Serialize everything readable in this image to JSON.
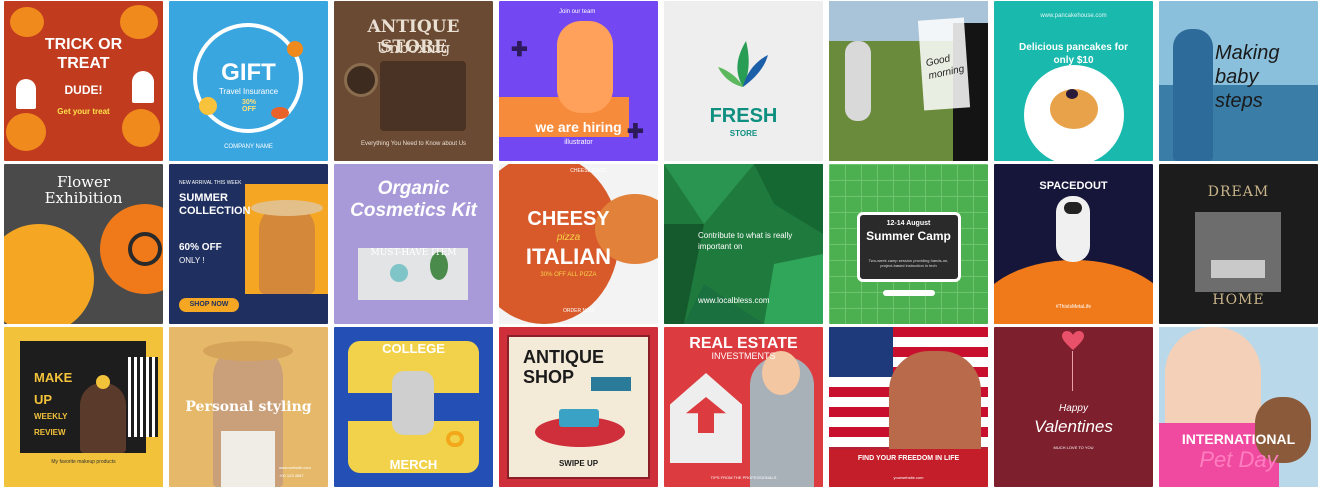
{
  "colors": {
    "halloween_bg": "#c13c1f",
    "gift_bg": "#3aa6e0",
    "antique_bg": "#6b4a33",
    "hiring_bg": "#7348f2",
    "fresh_green": "#0f8f80",
    "teal_bg": "#19b9ad",
    "flower_bg": "#555555",
    "summer_blue": "#1f2f60",
    "organic_bg": "#a89ad8",
    "polygon_green": "#1f7a3e",
    "camp_green": "#4caf50",
    "space_navy": "#15163a",
    "dark_bg": "#1c1c1c",
    "makeup_yellow": "#f2c23b",
    "styling_bg": "#e6b96a",
    "college_blue": "#2450b5",
    "antique_shop_red": "#cf2f3b",
    "realestate_red": "#dc3b3f",
    "valentine_maroon": "#7d1f2c",
    "pet_pink": "#f04aa0"
  },
  "tiles": {
    "t1": {
      "title": "TRICK OR TREAT",
      "sub": "DUDE!",
      "cta": "Get your treat"
    },
    "t2": {
      "title": "GIFT",
      "sub": "Travel Insurance",
      "disc": "30% OFF",
      "footer": "COMPANY NAME"
    },
    "t3": {
      "title": "ANTIQUE STORE",
      "sub": "Unboxing",
      "footer": "Everything You Need to Know about Us"
    },
    "t4": {
      "top": "Join our team",
      "title": "we are hiring",
      "sub": "illustrator"
    },
    "t5": {
      "title": "FRESH",
      "sub": "STORE"
    },
    "t6": {
      "title": "Good morning"
    },
    "t7": {
      "url": "www.pancakehouse.com",
      "title": "Delicious pancakes for only $10"
    },
    "t8": {
      "title": "Making baby steps"
    },
    "t9": {
      "title": "Flower Exhibition"
    },
    "t10": {
      "top": "NEW ARRIVAL THIS WEEK",
      "title": "SUMMER COLLECTION",
      "disc": "60% OFF",
      "sub": "ONLY !",
      "cta": "SHOP NOW"
    },
    "t11": {
      "title": "Organic Cosmetics Kit",
      "sub": "MUST-HAVE ITEM"
    },
    "t12": {
      "top": "CHEESE FOOD",
      "title": "CHEESY",
      "mid": "pizza",
      "title2": "ITALIAN",
      "disc": "30% OFF ALL PIZZA",
      "cta": "ORDER NOW"
    },
    "t13": {
      "title": "Contribute to what is really important on",
      "url": "www.localbless.com"
    },
    "t14": {
      "date": "12-14 August",
      "title": "Summer Camp",
      "sub": "Two-week camp session providing hands-on, project-based instruction in tech"
    },
    "t15": {
      "title": "SPACEDOUT",
      "tag": "#ThisIsMetaLife"
    },
    "t16": {
      "title": "DREAM",
      "title2": "HOME"
    },
    "t17": {
      "title": "MAKE UP",
      "sub": "WEEKLY REVIEW",
      "footer": "My favorite makeup products"
    },
    "t18": {
      "title": "Personal styling",
      "url": "www.website.com",
      "phone": "+00 123 4567"
    },
    "t19": {
      "title": "COLLEGE",
      "title2": "MERCH"
    },
    "t20": {
      "title": "ANTIQUE SHOP",
      "cta": "SWIPE UP"
    },
    "t21": {
      "title": "REAL ESTATE",
      "sub": "INVESTMENTS",
      "footer": "TIPS FROM THE PROFESSIONALS"
    },
    "t22": {
      "title": "FIND YOUR FREEDOM IN LIFE",
      "footer": "yourwebsite.com"
    },
    "t23": {
      "title": "Happy",
      "title2": "Valentines",
      "sub": "MUCH LOVE TO YOU"
    },
    "t24": {
      "title": "INTERNATIONAL",
      "title2": "Pet Day"
    }
  }
}
